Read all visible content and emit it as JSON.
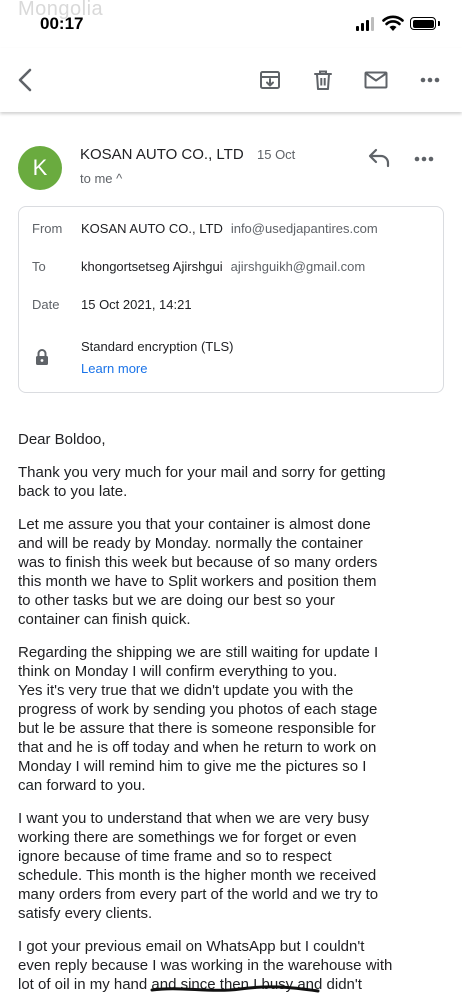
{
  "status_bar": {
    "ghost_text": "Mongolia",
    "time": "00:17"
  },
  "toolbar": {
    "back_icon": "chevron-left-icon",
    "archive_icon": "archive-icon",
    "delete_icon": "trash-icon",
    "mark_unread_icon": "mail-icon",
    "more_icon": "more-horizontal-icon"
  },
  "message": {
    "avatar_letter": "K",
    "avatar_color": "#6aab3f",
    "sender": "KOSAN AUTO CO., LTD",
    "date": "15 Oct",
    "to_me": "to me ^"
  },
  "details": {
    "from_label": "From",
    "from_name": "KOSAN AUTO CO., LTD",
    "from_email": "info@usedjapantires.com",
    "to_label": "To",
    "to_name": "khongortsetseg Ajirshgui",
    "to_email": "ajirshguikh@gmail.com",
    "date_label": "Date",
    "date_value": "15 Oct 2021, 14:21",
    "encryption": "Standard encryption (TLS)",
    "learn_more": "Learn more",
    "link_color": "#1a73e8"
  },
  "body": {
    "paragraphs": [
      "Dear Boldoo,",
      "Thank you very much for your mail and sorry for getting\nback to you late.",
      "Let me assure you that your container is almost done\nand will be ready by Monday. normally the container\nwas to finish this week but because of so many orders\nthis month we have to Split workers and position them\nto other tasks but we are doing our best so your\ncontainer can finish quick.",
      "Regarding the shipping we are still waiting for update I\nthink on Monday I will confirm everything to you.\nYes it's very true that we didn't update you with the\nprogress of work by sending you photos of each stage\nbut le be assure that there is someone responsible for\nthat and he is off today and when he return to work on\nMonday I will remind him to give me the pictures so I\ncan forward to you.",
      "I want you to understand that when we are very busy\nworking there are somethings we for forget or even\nignore because of time frame and so to respect\nschedule.  This month is the higher month we received\nmany orders from every part of the world and we try to\nsatisfy every clients.",
      "I got your previous email on WhatsApp but I couldn't\neven reply because I was working in the warehouse with\nlot of oil in my hand and since then I busy and didn't"
    ]
  }
}
